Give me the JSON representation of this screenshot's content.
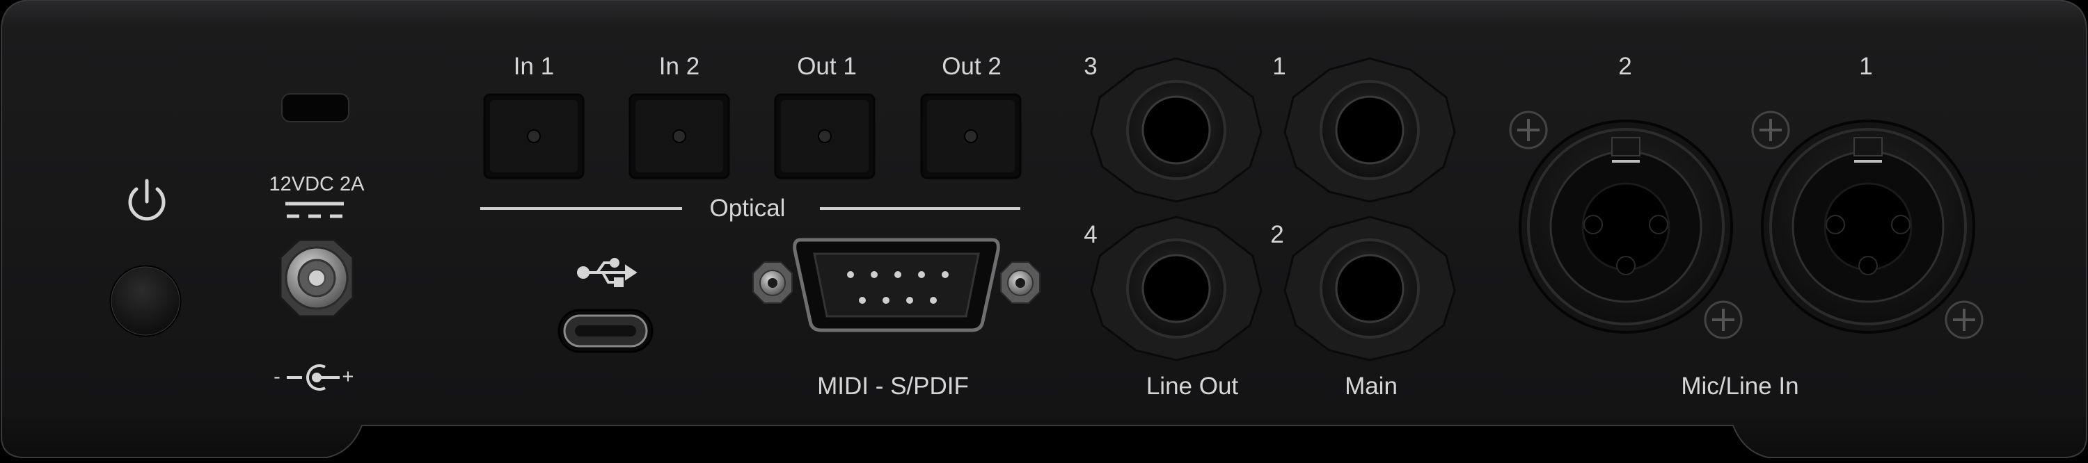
{
  "device": {
    "power": {
      "icon": "power-icon"
    },
    "dc_input": {
      "rating": "12VDC 2A",
      "polarity_minus": "-",
      "polarity_plus": "+",
      "icons": [
        "dc-symbol-icon",
        "polarity-icon"
      ]
    },
    "optical": {
      "group_label": "Optical",
      "ports": [
        "In 1",
        "In 2",
        "Out 1",
        "Out 2"
      ]
    },
    "usb": {
      "icon": "usb-icon"
    },
    "midi_spdif": {
      "label": "MIDI - S/PDIF"
    },
    "jacks": {
      "numbers": [
        "3",
        "1",
        "4",
        "2"
      ],
      "line_out_label": "Line Out",
      "main_label": "Main"
    },
    "mic_line_in": {
      "numbers": [
        "2",
        "1"
      ],
      "label": "Mic/Line In"
    },
    "colors": {
      "chassis": "#161617",
      "label": "#d6d6d6",
      "background": "#000000"
    }
  }
}
